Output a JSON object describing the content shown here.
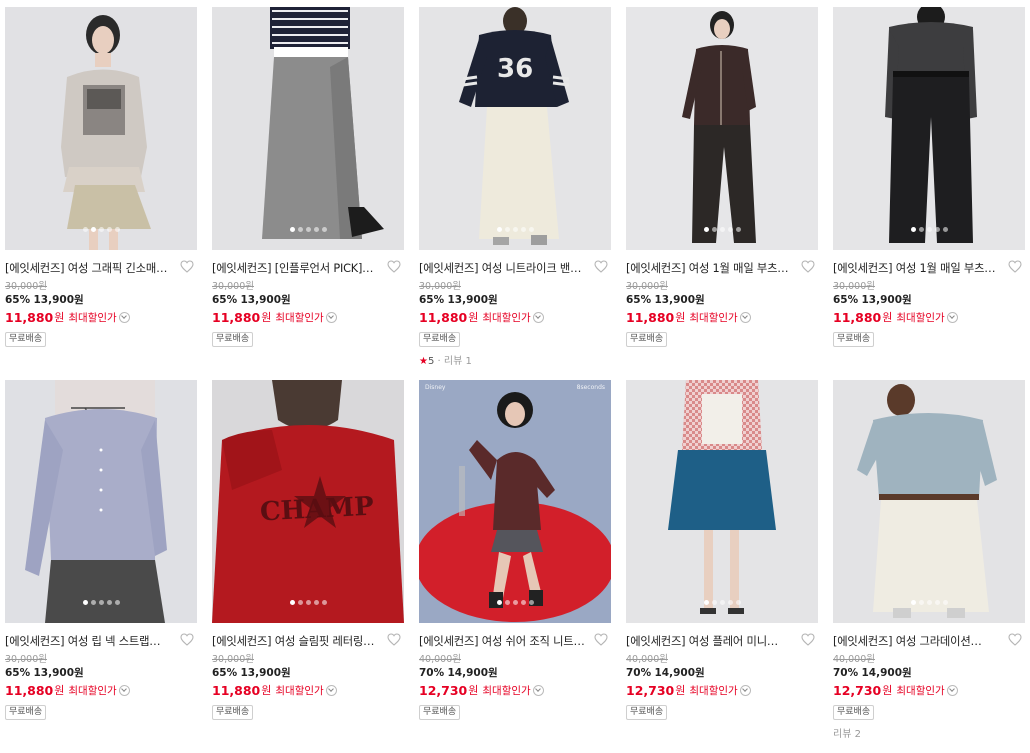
{
  "products": [
    {
      "title": "[에잇세컨즈] 여성 그래픽 긴소매…",
      "orig": "30,000원",
      "pct": "65%",
      "price": "13,900원",
      "max_price": "11,880",
      "won": "원",
      "max_label": "최대할인가",
      "badge": "무료배송",
      "review": null,
      "scene": "s1",
      "active_dot": 1
    },
    {
      "title": "[에잇세컨즈] [인플루언서 PICK]…",
      "orig": "30,000원",
      "pct": "65%",
      "price": "13,900원",
      "max_price": "11,880",
      "won": "원",
      "max_label": "최대할인가",
      "badge": "무료배송",
      "review": null,
      "scene": "s2",
      "active_dot": 0
    },
    {
      "title": "[에잇세컨즈] 여성 니트라이크 밴…",
      "orig": "30,000원",
      "pct": "65%",
      "price": "13,900원",
      "max_price": "11,880",
      "won": "원",
      "max_label": "최대할인가",
      "badge": "무료배송",
      "review": {
        "star": "★",
        "score": "5",
        "sep": "·",
        "label": "리뷰 1"
      },
      "scene": "s3",
      "active_dot": 0
    },
    {
      "title": "[에잇세컨즈] 여성 1월 매일 부츠…",
      "orig": "30,000원",
      "pct": "65%",
      "price": "13,900원",
      "max_price": "11,880",
      "won": "원",
      "max_label": "최대할인가",
      "badge": "무료배송",
      "review": null,
      "scene": "s4",
      "active_dot": 0
    },
    {
      "title": "[에잇세컨즈] 여성 1월 매일 부츠…",
      "orig": "30,000원",
      "pct": "65%",
      "price": "13,900원",
      "max_price": "11,880",
      "won": "원",
      "max_label": "최대할인가",
      "badge": "무료배송",
      "review": null,
      "scene": "s5",
      "active_dot": 0
    },
    {
      "title": "[에잇세컨즈] 여성 립 넥 스트랩…",
      "orig": "30,000원",
      "pct": "65%",
      "price": "13,900원",
      "max_price": "11,880",
      "won": "원",
      "max_label": "최대할인가",
      "badge": "무료배송",
      "review": null,
      "scene": "s6",
      "active_dot": 0
    },
    {
      "title": "[에잇세컨즈] 여성 슬림핏 레터링…",
      "orig": "30,000원",
      "pct": "65%",
      "price": "13,900원",
      "max_price": "11,880",
      "won": "원",
      "max_label": "최대할인가",
      "badge": "무료배송",
      "review": null,
      "scene": "s7",
      "active_dot": 0
    },
    {
      "title": "[에잇세컨즈] 여성 쉬어 조직 니트…",
      "orig": "40,000원",
      "pct": "70%",
      "price": "14,900원",
      "max_price": "12,730",
      "won": "원",
      "max_label": "최대할인가",
      "badge": "무료배송",
      "review": null,
      "scene": "s8",
      "active_dot": 0,
      "marks": {
        "left": "Disney",
        "right": "8seconds"
      }
    },
    {
      "title": "[에잇세컨즈] 여성 플레어 미니…",
      "orig": "40,000원",
      "pct": "70%",
      "price": "14,900원",
      "max_price": "12,730",
      "won": "원",
      "max_label": "최대할인가",
      "badge": "무료배송",
      "review": null,
      "scene": "s9",
      "active_dot": 0
    },
    {
      "title": "[에잇세컨즈] 여성 그라데이션…",
      "orig": "40,000원",
      "pct": "70%",
      "price": "14,900원",
      "max_price": "12,730",
      "won": "원",
      "max_label": "최대할인가",
      "badge": "무료배송",
      "review": {
        "label": "리뷰 2"
      },
      "scene": "s10",
      "active_dot": 0
    }
  ]
}
